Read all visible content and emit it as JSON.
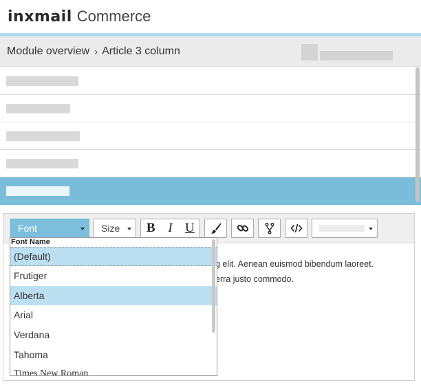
{
  "header": {
    "brand": "inxmail",
    "product": "Commerce"
  },
  "breadcrumb": {
    "parent": "Module overview",
    "separator": "›",
    "current": "Article 3 column"
  },
  "modules": {
    "selected_index": 4,
    "count": 5
  },
  "toolbar": {
    "font_label": "Font",
    "size_label": "Size",
    "bold_label": "B",
    "italic_label": "I",
    "underline_label": "U",
    "icons": [
      "brush-icon",
      "link-icon",
      "branch-icon",
      "code-icon"
    ]
  },
  "font_dropdown": {
    "header": "Font Name",
    "options": [
      "(Default)",
      "Frutiger",
      "Alberta",
      "Arial",
      "Verdana",
      "Tahoma",
      "Times New Roman"
    ],
    "selected": "(Default)",
    "highlighted": "Alberta"
  },
  "editor": {
    "line1": "g elit. Aenean euismod bibendum laoreet.",
    "line2": "erra justo commodo."
  },
  "colors": {
    "accent": "#aedbeb",
    "selected_row": "#79bddb",
    "font_select": "#7bbfdd",
    "dropdown_highlight": "#bddff2"
  }
}
